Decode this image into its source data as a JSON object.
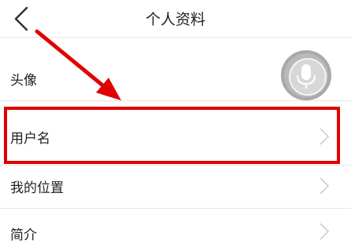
{
  "header": {
    "title": "个人资料",
    "back_icon": "chevron-left-icon"
  },
  "rows": [
    {
      "label": "头像",
      "icon": "avatar-microphone-icon"
    },
    {
      "label": "用户名",
      "icon": "chevron-right-icon"
    },
    {
      "label": "我的位置",
      "icon": "chevron-right-icon"
    },
    {
      "label": "简介",
      "icon": "chevron-right-icon"
    }
  ],
  "annotation": {
    "color": "#e00000",
    "highlighted_row": "用户名"
  }
}
